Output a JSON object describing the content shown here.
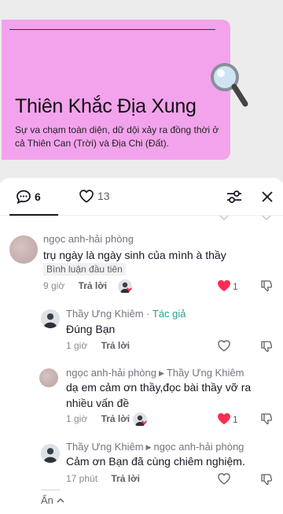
{
  "post": {
    "title": "Thiên Khắc Địa Xung",
    "subtitle": "Sự va chạm toàn diện, dữ dội xảy ra đồng thời ở cả Thiên Can (Trời) và Địa Chi (Đất)."
  },
  "tabs": {
    "comments_count": "6",
    "likes_count": "13"
  },
  "comments": [
    {
      "user": "ngọc anh-hải phòng",
      "text": "trụ ngày là ngày sinh của mình à thầy",
      "badge": "Bình luận đầu tiên",
      "time": "9 giờ",
      "reply": "Trả lời",
      "likes": "1",
      "liked": true
    },
    {
      "user": "Thầy Ưng Khiêm",
      "author_tag": "Tác giả",
      "text": "Đúng Bạn",
      "time": "1 giờ",
      "reply": "Trả lời"
    },
    {
      "user": "ngọc anh-hải phòng",
      "reply_to": "Thầy Ưng Khiêm",
      "text": "dạ em cảm ơn thầy,đọc bài thầy vỡ ra nhiều vấn đề",
      "time": "1 giờ",
      "reply": "Trả lời",
      "likes": "1",
      "liked": true
    },
    {
      "user": "Thầy Ưng Khiêm",
      "reply_to": "ngọc anh-hải phòng",
      "text": "Cảm ơn Bạn đã cùng chiêm nghiệm.",
      "time": "17 phút",
      "reply": "Trả lời"
    }
  ],
  "hide_label": "Ẩn",
  "colors": {
    "accent_heart": "#fe2c55",
    "author_tag": "#2a9e8f",
    "card_bg": "#f2a3ec"
  },
  "icons": [
    "comment-icon",
    "heart-outline-icon",
    "filter-icon",
    "close-icon",
    "magnifier-icon",
    "thumb-down-icon",
    "chevron-up-icon"
  ]
}
